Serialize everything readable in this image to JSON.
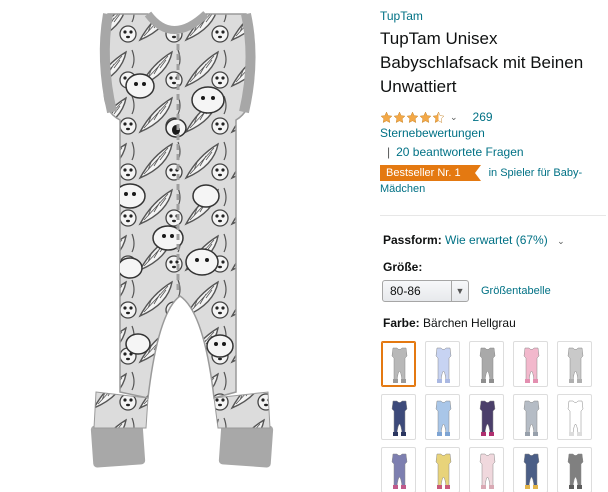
{
  "product": {
    "brand": "TupTam",
    "title": "TupTam Unisex Babyschlafsack mit Beinen Unwattiert"
  },
  "rating": {
    "stars": 4.5,
    "count": "269",
    "count_suffix": "Sternebewertungen",
    "separator": "|",
    "questions": "20 beantwortete Fragen"
  },
  "bestseller": {
    "badge": "Bestseller Nr. 1",
    "category_line1": "in Spieler für Baby-",
    "category_line2": "Mädchen"
  },
  "fit": {
    "label": "Passform:",
    "value": "Wie erwartet (67%)"
  },
  "size": {
    "label": "Größe:",
    "selected": "80-86",
    "chart_link": "Größentabelle"
  },
  "color": {
    "label": "Farbe:",
    "selected": "Bärchen Hellgrau"
  },
  "swatches": [
    {
      "main": "#b8b8b8",
      "trim": "#9a9a9a",
      "selected": true
    },
    {
      "main": "#c7d3f2",
      "trim": "#aab8e2",
      "selected": false
    },
    {
      "main": "#a9a9a9",
      "trim": "#8f8f8f",
      "selected": false
    },
    {
      "main": "#f2b8cc",
      "trim": "#e38fb0",
      "selected": false
    },
    {
      "main": "#c9c9c9",
      "trim": "#b0b0b0",
      "selected": false
    },
    {
      "main": "#3d4a7a",
      "trim": "#2c3760",
      "selected": false
    },
    {
      "main": "#a9c6e8",
      "trim": "#7ea4d3",
      "selected": false
    },
    {
      "main": "#4b3f6a",
      "trim": "#b0306f",
      "selected": false
    },
    {
      "main": "#b5bcc5",
      "trim": "#97a0ab",
      "selected": false
    },
    {
      "main": "#ffffff",
      "trim": "#dcdcdc",
      "selected": false
    },
    {
      "main": "#7d7fb0",
      "trim": "#c05a8a",
      "selected": false
    },
    {
      "main": "#e8d37a",
      "trim": "#c85a7a",
      "selected": false
    },
    {
      "main": "#f0d8dd",
      "trim": "#d9a9b4",
      "selected": false
    },
    {
      "main": "#4b5e86",
      "trim": "#e2b44a",
      "selected": false
    },
    {
      "main": "#808080",
      "trim": "#5d5d5d",
      "selected": false
    }
  ],
  "colors": {
    "link": "#007185",
    "badge": "#e47911",
    "star": "#f3a847",
    "garment": "#d9d9d9",
    "garment_trim": "#a7a7a7"
  }
}
